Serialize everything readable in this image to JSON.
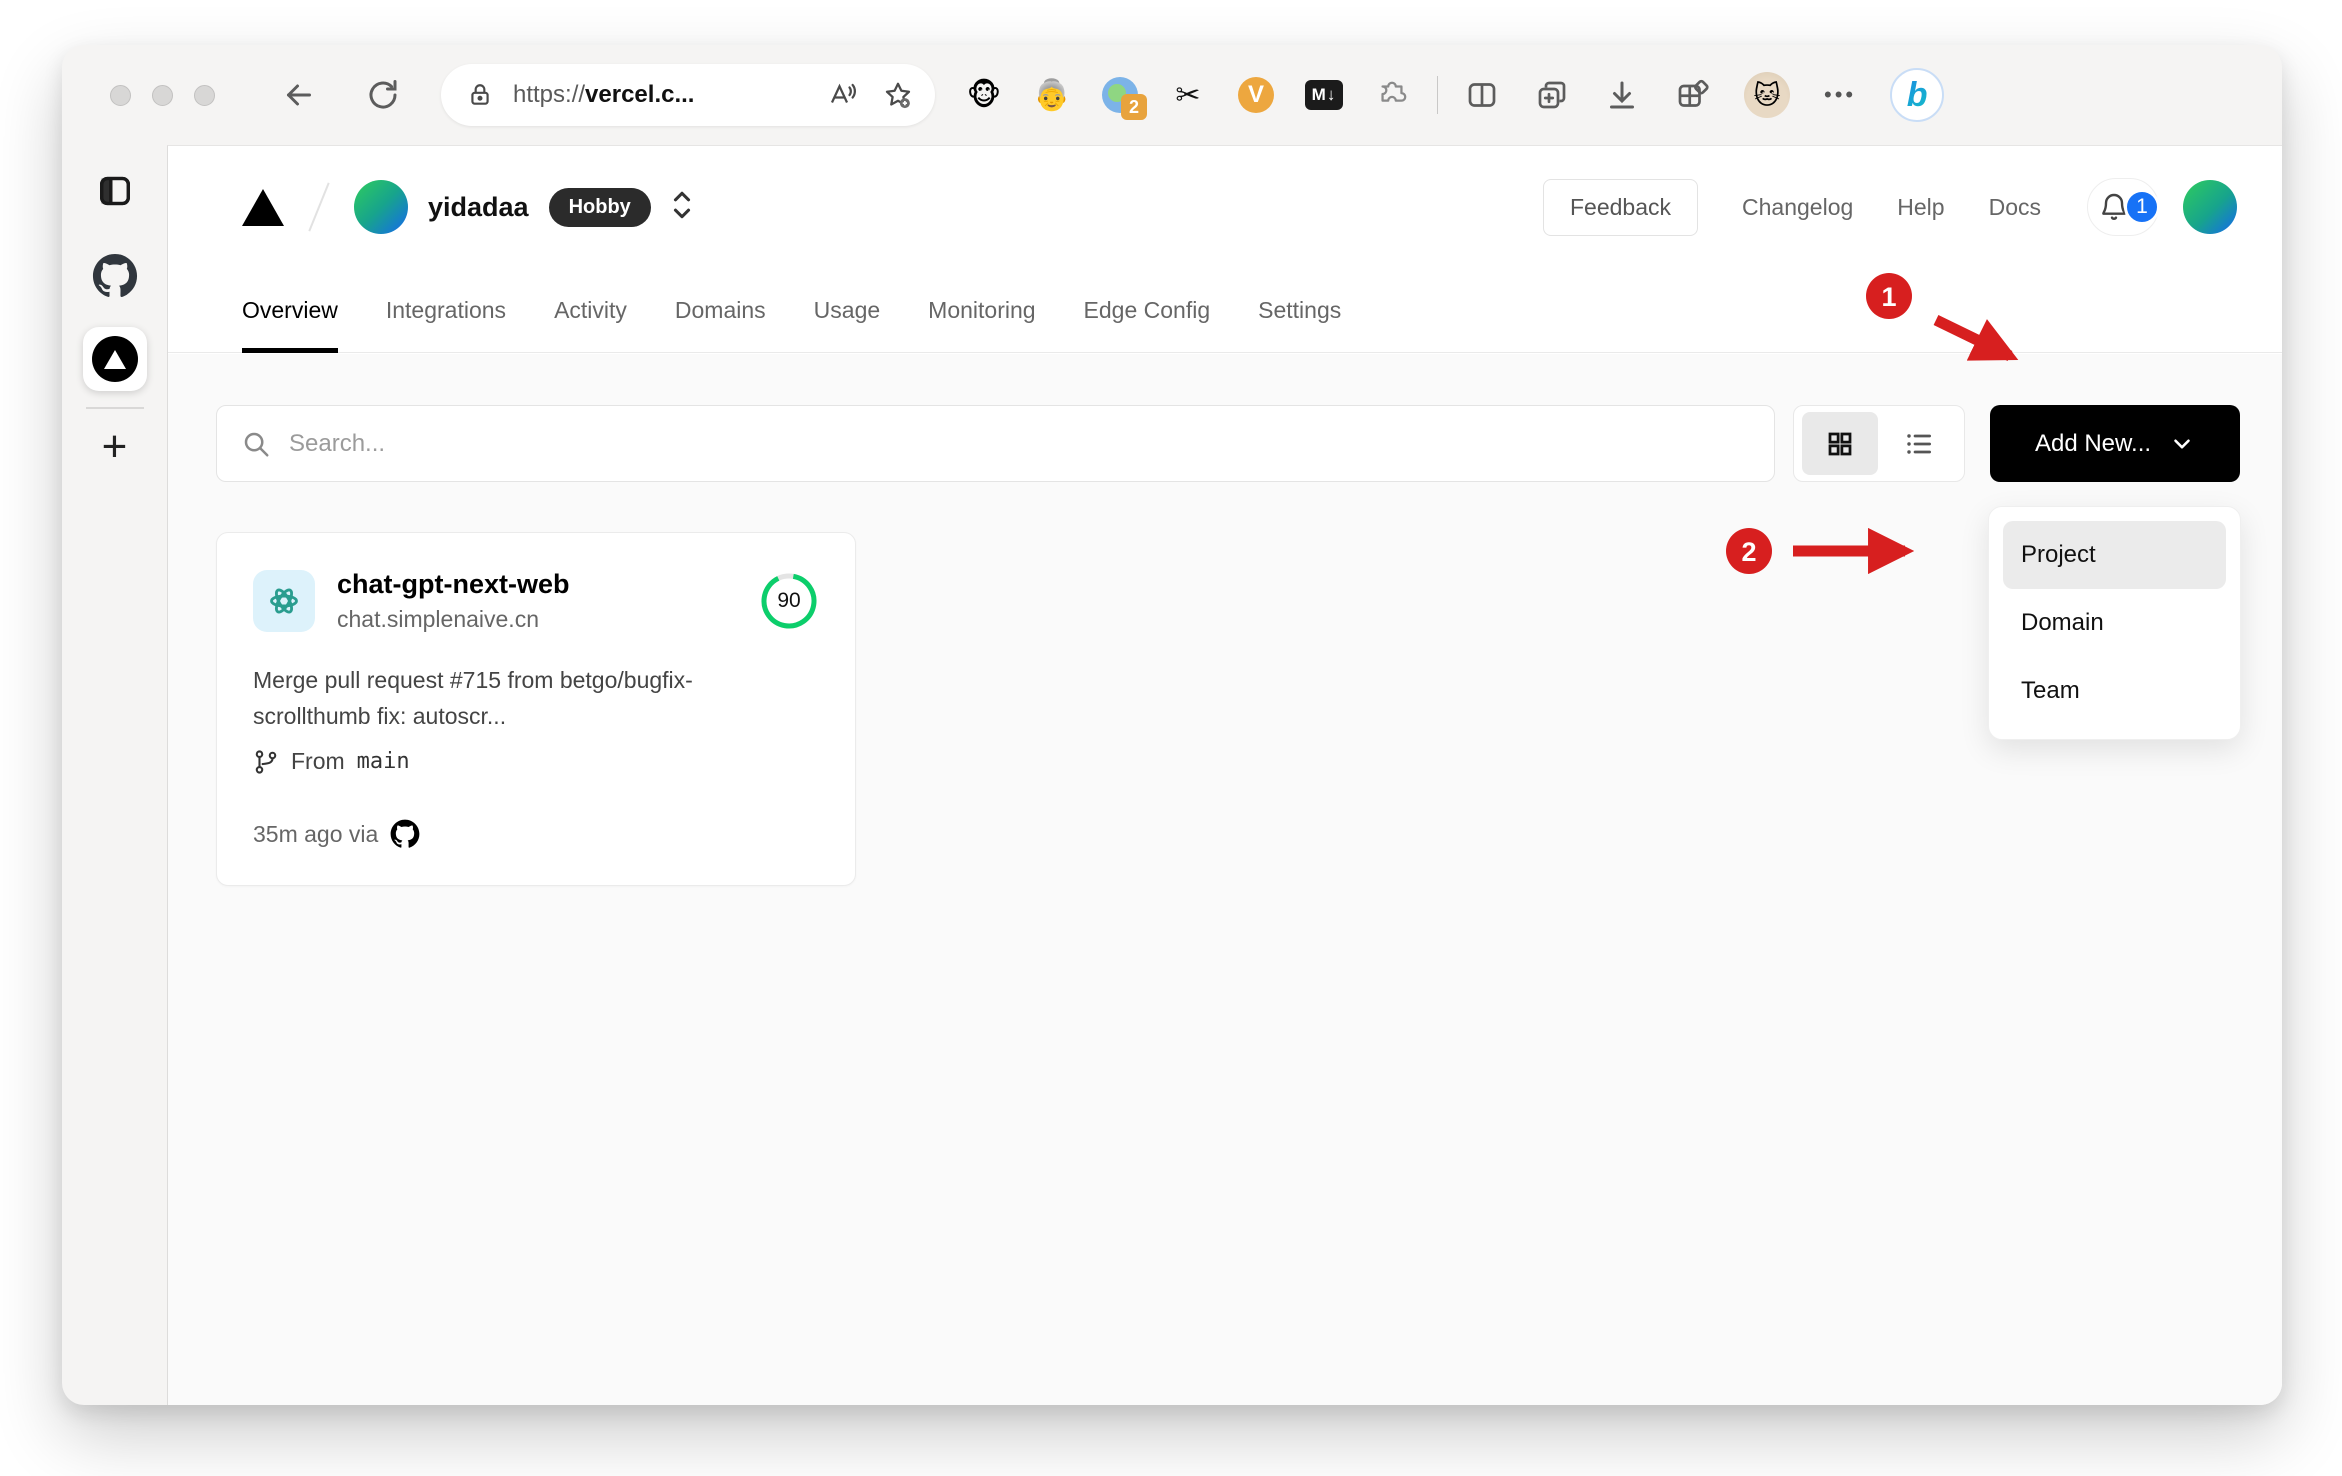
{
  "colors": {
    "annotation_red": "#d71f1f",
    "vercel_black": "#000000",
    "notification_blue": "#1772f6",
    "score_ring_green": "#0cce6b",
    "openai_teal": "#2a9d8f",
    "openai_logo_bg": "#ddf2fb",
    "content_bg": "#fafafa"
  },
  "browser": {
    "url_scheme": "https://",
    "url_domain": "vercel.c...",
    "extension_badge_count": "2",
    "ext_monkey": "🐵",
    "ext_grandma": "👵",
    "ext_v_label": "V",
    "ext_md_label": "M↓",
    "bing_label": "b",
    "cat_avatar": "🐱",
    "ellipsis": "•••",
    "new_tab_plus": "+"
  },
  "header": {
    "team_name": "yidadaa",
    "plan_badge": "Hobby",
    "feedback_label": "Feedback",
    "links": [
      "Changelog",
      "Help",
      "Docs"
    ],
    "notification_count": "1"
  },
  "tabs": [
    {
      "label": "Overview",
      "active": true
    },
    {
      "label": "Integrations",
      "active": false
    },
    {
      "label": "Activity",
      "active": false
    },
    {
      "label": "Domains",
      "active": false
    },
    {
      "label": "Usage",
      "active": false
    },
    {
      "label": "Monitoring",
      "active": false
    },
    {
      "label": "Edge Config",
      "active": false
    },
    {
      "label": "Settings",
      "active": false
    }
  ],
  "controls": {
    "search_placeholder": "Search...",
    "add_new_label": "Add New..."
  },
  "dropdown": {
    "items": [
      "Project",
      "Domain",
      "Team"
    ],
    "highlighted": "Project"
  },
  "project_card": {
    "name": "chat-gpt-next-web",
    "domain": "chat.simplenaive.cn",
    "score": "90",
    "commit_message": "Merge pull request #715 from betgo/bugfix-scrollthumb fix: autoscr...",
    "branch_prefix": "From",
    "branch_name": "main",
    "deployed_text": "35m ago via"
  },
  "annotations": {
    "step1": "1",
    "step2": "2"
  }
}
